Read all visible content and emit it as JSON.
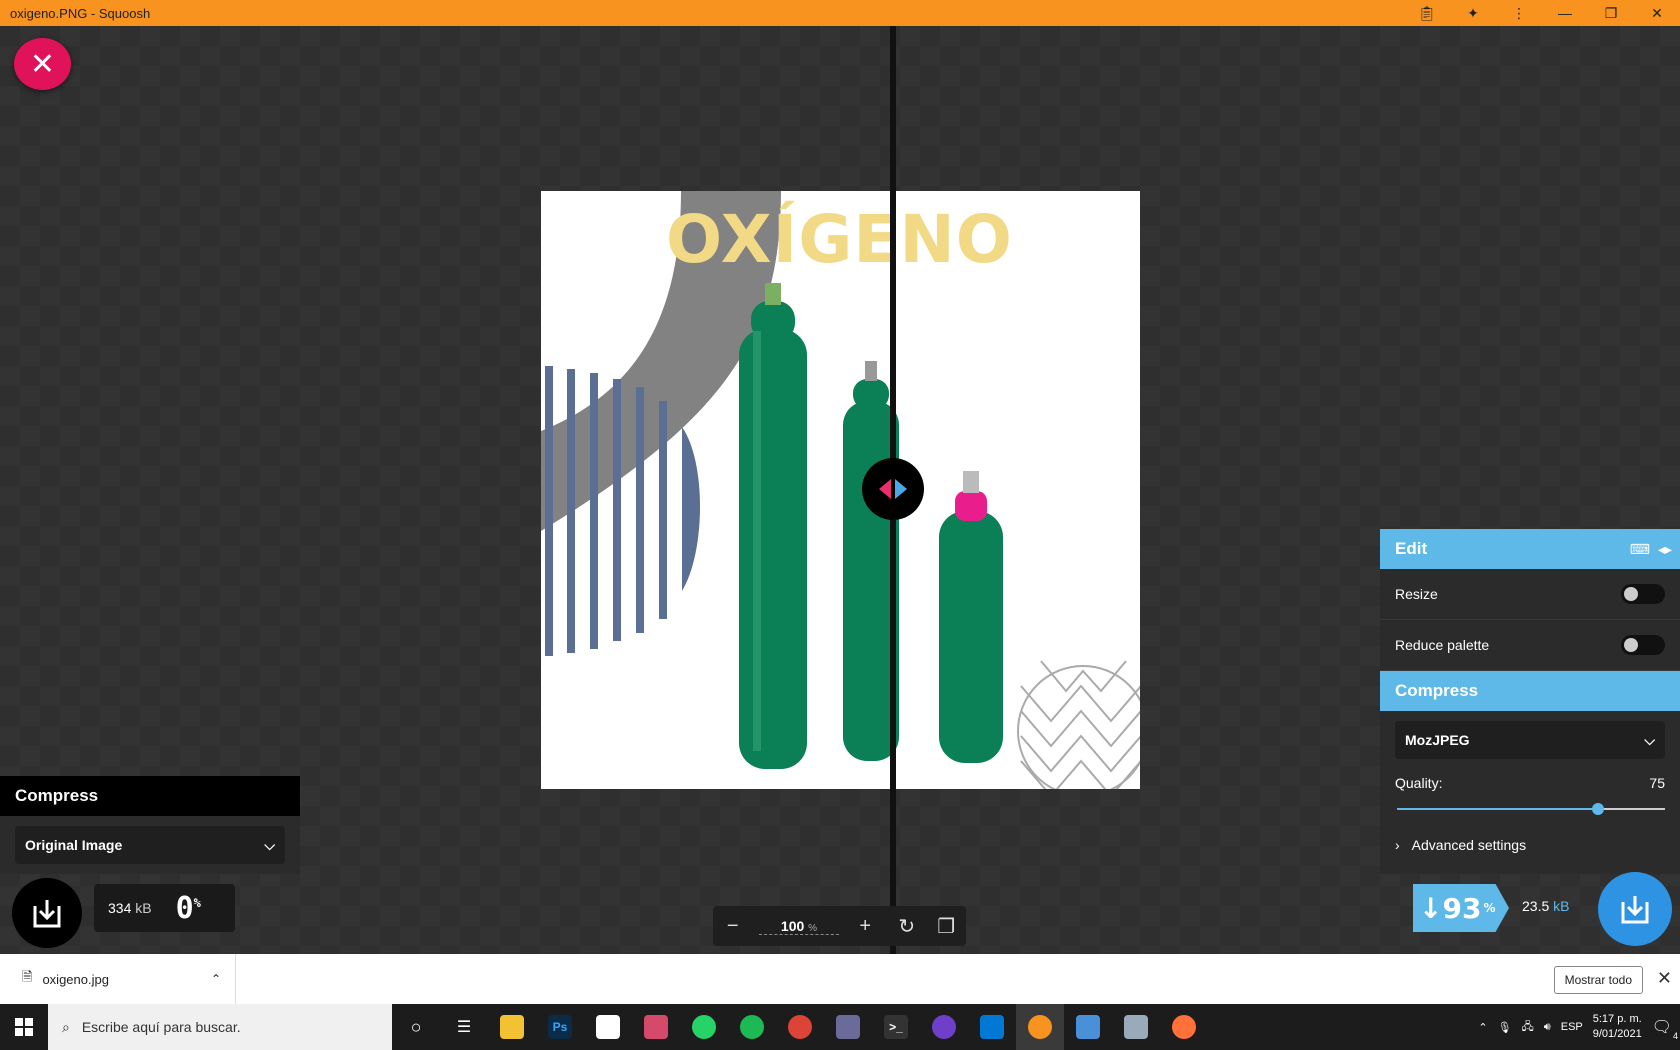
{
  "window": {
    "title": "oxigeno.PNG - Squoosh"
  },
  "colors": {
    "accent_orange": "#f7931e",
    "accent_blue": "#5eb8e8",
    "close_pink": "#e0125a"
  },
  "image": {
    "logo_text": "OXÍGENO"
  },
  "left_panel": {
    "heading": "Compress",
    "encoder": "Original Image",
    "size": "334",
    "size_unit": "kB",
    "percent": "0",
    "percent_unit": "%"
  },
  "zoom": {
    "value": "100",
    "unit": "%"
  },
  "right_panel": {
    "edit_heading": "Edit",
    "resize_label": "Resize",
    "resize_on": false,
    "reduce_palette_label": "Reduce palette",
    "reduce_palette_on": false,
    "compress_heading": "Compress",
    "encoder": "MozJPEG",
    "quality_label": "Quality:",
    "quality_value": "75",
    "quality_fraction": 0.75,
    "advanced_label": "Advanced settings",
    "reduction_percent": "↓93",
    "reduction_unit": "%",
    "size": "23.5",
    "size_unit": "kB"
  },
  "downloads": {
    "file_name": "oxigeno.jpg",
    "show_all": "Mostrar todo"
  },
  "taskbar": {
    "search_placeholder": "Escribe aquí para buscar.",
    "language": "ESP",
    "time": "5:17 p. m.",
    "date": "9/01/2021",
    "notification_count": "4",
    "apps": [
      "file-explorer",
      "photoshop",
      "store",
      "paint",
      "whatsapp",
      "spotify",
      "chrome",
      "discord-like",
      "terminal",
      "github",
      "vscode",
      "squoosh",
      "remote",
      "paint-3d",
      "firefox"
    ]
  }
}
